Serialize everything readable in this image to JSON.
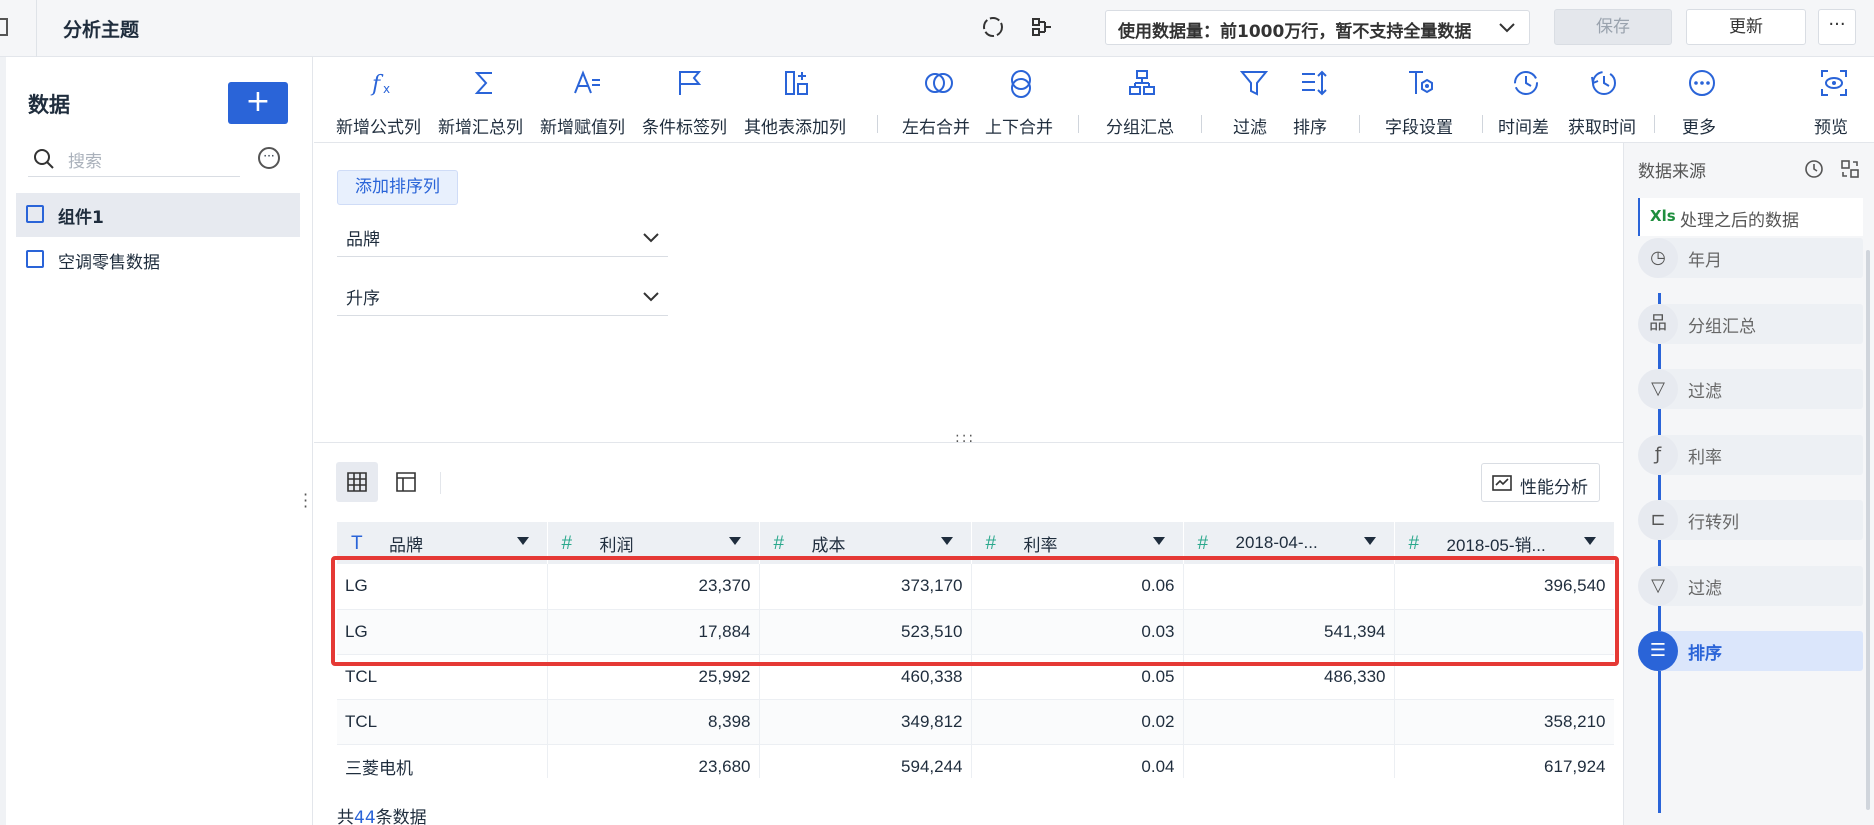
{
  "header": {
    "title": "分析主题",
    "data_volume": "使用数据量：前1000万行，暂不支持全量数据",
    "save_label": "保存",
    "update_label": "更新",
    "more_label": "···"
  },
  "sidebar": {
    "title": "数据",
    "add_label": "+",
    "search_placeholder": "搜索",
    "items": [
      {
        "label": "组件1",
        "active": true
      },
      {
        "label": "空调零售数据",
        "active": false
      }
    ]
  },
  "toolbar": {
    "items": [
      {
        "label": "新增公式列",
        "icon": "formula-icon"
      },
      {
        "label": "新增汇总列",
        "icon": "sum-icon"
      },
      {
        "label": "新增赋值列",
        "icon": "assign-icon"
      },
      {
        "label": "条件标签列",
        "icon": "flag-icon"
      },
      {
        "label": "其他表添加列",
        "icon": "add-column-icon"
      },
      {
        "label": "左右合并",
        "icon": "merge-horizontal-icon"
      },
      {
        "label": "上下合并",
        "icon": "merge-vertical-icon"
      },
      {
        "label": "分组汇总",
        "icon": "group-icon"
      },
      {
        "label": "过滤",
        "icon": "filter-icon"
      },
      {
        "label": "排序",
        "icon": "sort-icon"
      },
      {
        "label": "字段设置",
        "icon": "field-settings-icon"
      },
      {
        "label": "时间差",
        "icon": "time-diff-icon"
      },
      {
        "label": "获取时间",
        "icon": "get-time-icon"
      },
      {
        "label": "更多",
        "icon": "more-icon"
      },
      {
        "label": "预览",
        "icon": "preview-icon"
      }
    ]
  },
  "sort_panel": {
    "add_sort_label": "添加排序列",
    "field_value": "品牌",
    "order_value": "升序"
  },
  "preview": {
    "perf_label": "性能分析",
    "columns": [
      {
        "label": "品牌",
        "type": "T"
      },
      {
        "label": "利润",
        "type": "#"
      },
      {
        "label": "成本",
        "type": "#"
      },
      {
        "label": "利率",
        "type": "#"
      },
      {
        "label": "2018-04-...",
        "type": "#"
      },
      {
        "label": "2018-05-销...",
        "type": "#"
      }
    ],
    "rows": [
      [
        "LG",
        "23,370",
        "373,170",
        "0.06",
        "",
        "396,540"
      ],
      [
        "LG",
        "17,884",
        "523,510",
        "0.03",
        "541,394",
        ""
      ],
      [
        "TCL",
        "25,992",
        "460,338",
        "0.05",
        "486,330",
        ""
      ],
      [
        "TCL",
        "8,398",
        "349,812",
        "0.02",
        "",
        "358,210"
      ],
      [
        "三菱电机",
        "23,680",
        "594,244",
        "0.04",
        "",
        "617,924"
      ]
    ],
    "count_prefix": "共",
    "count_value": "44",
    "count_suffix": "条数据"
  },
  "right_panel": {
    "title": "数据来源",
    "source_badge": "Xls",
    "source_label": "处理之后的数据",
    "steps": [
      {
        "label": "年月",
        "icon": "clock-icon"
      },
      {
        "label": "分组汇总",
        "icon": "group-icon"
      },
      {
        "label": "过滤",
        "icon": "filter-icon"
      },
      {
        "label": "利率",
        "icon": "formula-icon"
      },
      {
        "label": "行转列",
        "icon": "pivot-icon"
      },
      {
        "label": "过滤",
        "icon": "filter-icon"
      },
      {
        "label": "排序",
        "icon": "sort-icon",
        "active": true
      }
    ]
  },
  "colors": {
    "accent": "#2a64d8",
    "highlight": "#e53935",
    "numeric_type": "#2aa88c"
  }
}
